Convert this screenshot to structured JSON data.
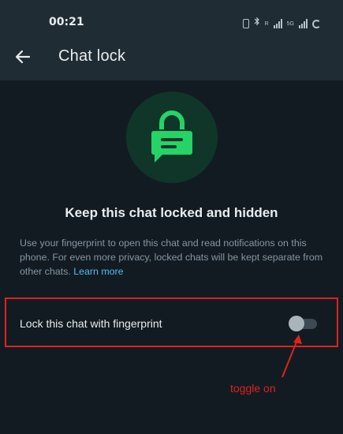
{
  "status_bar": {
    "time": "00:21",
    "icons": [
      "vibrate-icon",
      "bluetooth-icon",
      "signal-icon",
      "5g-signal-icon",
      "battery-icon"
    ],
    "network_label": "5G",
    "roaming_label": "R"
  },
  "header": {
    "title": "Chat lock",
    "back_icon": "arrow-left-icon"
  },
  "hero": {
    "icon": "chat-lock-icon",
    "accent": "#25d366",
    "background": "#103629"
  },
  "main": {
    "heading": "Keep this chat locked and hidden",
    "description": "Use your fingerprint to open this chat and read notifications on this phone. For even more privacy, locked chats will be kept separate from other chats.",
    "learn_more": "Learn more"
  },
  "setting": {
    "label": "Lock this chat with fingerprint",
    "enabled": false
  },
  "annotation": {
    "text": "toggle on",
    "color": "#e0221f"
  },
  "colors": {
    "background": "#121b22",
    "app_bar": "#1f2c34",
    "link": "#53bdeb",
    "secondary_text": "#8696a0"
  }
}
